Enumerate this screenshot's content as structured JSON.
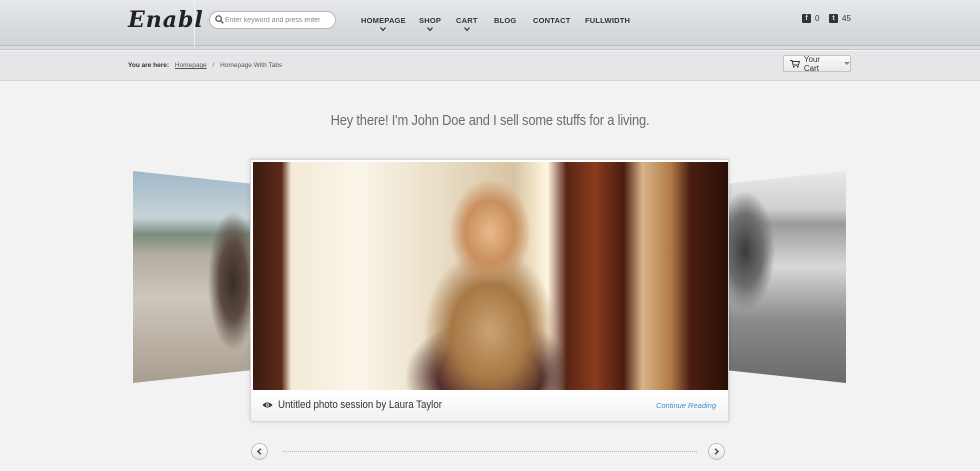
{
  "header": {
    "logo": "Enabl",
    "search_placeholder": "Enter keyword and press enter",
    "nav": [
      {
        "label": "HOMEPAGE",
        "has_dropdown": true
      },
      {
        "label": "SHOP",
        "has_dropdown": true
      },
      {
        "label": "CART",
        "has_dropdown": true
      },
      {
        "label": "BLOG",
        "has_dropdown": false
      },
      {
        "label": "CONTACT",
        "has_dropdown": false
      },
      {
        "label": "FULLWIDTH",
        "has_dropdown": false
      }
    ],
    "social": [
      {
        "icon": "facebook-icon",
        "count": "0"
      },
      {
        "icon": "twitter-icon",
        "count": "45"
      }
    ]
  },
  "breadcrumb": {
    "prefix": "You are here:",
    "home": "Homepage",
    "separator": "/",
    "current": "Homepage With Tabs"
  },
  "cart": {
    "label": "Your Cart"
  },
  "hero": {
    "headline": "Hey there! I'm John Doe and I sell some stuffs for a living."
  },
  "slide": {
    "title": "Untitled photo session by Laura Taylor",
    "link": "Continue Reading"
  },
  "colors": {
    "link": "#3a8ed6",
    "headline": "#6c6c6c"
  }
}
